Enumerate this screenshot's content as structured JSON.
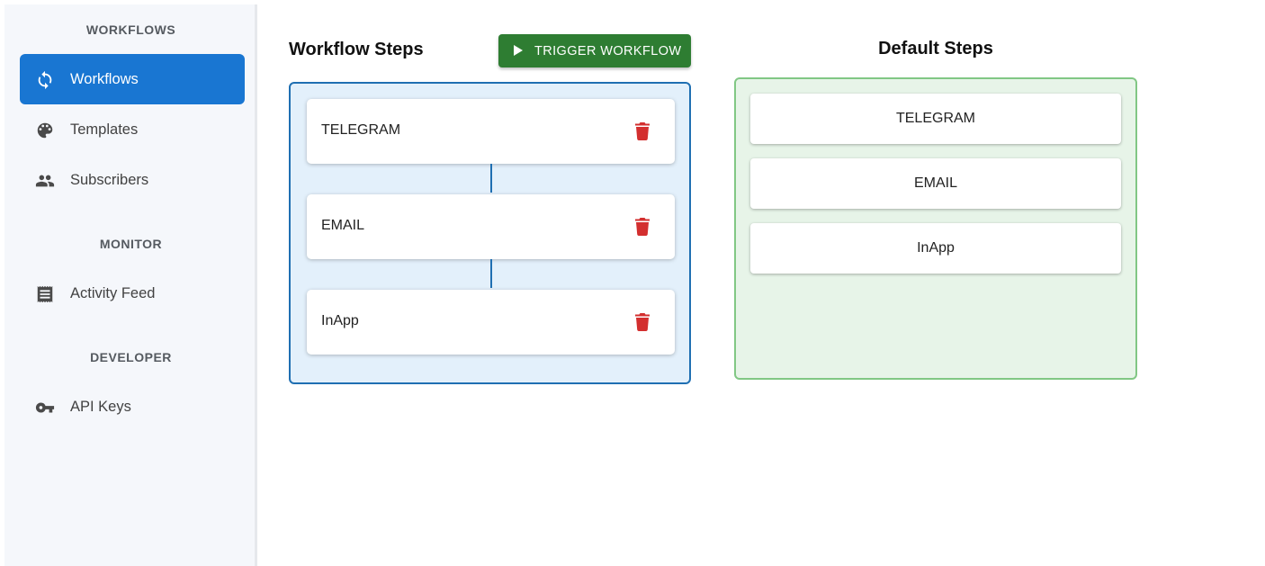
{
  "sidebar": {
    "sections": [
      {
        "title": "WORKFLOWS"
      },
      {
        "title": "MONITOR"
      },
      {
        "title": "DEVELOPER"
      }
    ],
    "items": [
      {
        "label": "Workflows",
        "icon": "sync-icon",
        "active": true
      },
      {
        "label": "Templates",
        "icon": "palette-icon"
      },
      {
        "label": "Subscribers",
        "icon": "people-icon"
      },
      {
        "label": "Activity Feed",
        "icon": "receipt-icon"
      },
      {
        "label": "API Keys",
        "icon": "key-icon"
      }
    ]
  },
  "workflow": {
    "title": "Workflow Steps",
    "trigger_label": "TRIGGER WORKFLOW",
    "steps": [
      {
        "label": "TELEGRAM"
      },
      {
        "label": "EMAIL"
      },
      {
        "label": "InApp"
      }
    ]
  },
  "defaults": {
    "title": "Default Steps",
    "steps": [
      {
        "label": "TELEGRAM"
      },
      {
        "label": "EMAIL"
      },
      {
        "label": "InApp"
      }
    ]
  },
  "colors": {
    "primary": "#1976d2",
    "success": "#2e7d32",
    "danger": "#d32f2f",
    "workflow_panel_bg": "#e3f0fb",
    "default_panel_bg": "#e7f4e8"
  }
}
